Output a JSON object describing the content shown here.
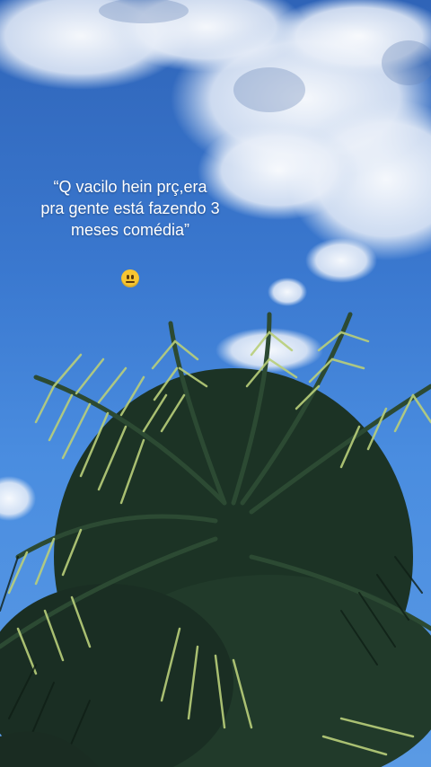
{
  "caption": {
    "text": "“Q vacilo hein prç,era\npra gente está fazendo 3\nmeses comédia”",
    "emoji_icon": "neutral-face-icon"
  },
  "colors": {
    "sky": "#3a78cf",
    "cloud": "#f2f5fa",
    "palm_dark": "#1e3527",
    "palm_light": "#c9d98a"
  }
}
